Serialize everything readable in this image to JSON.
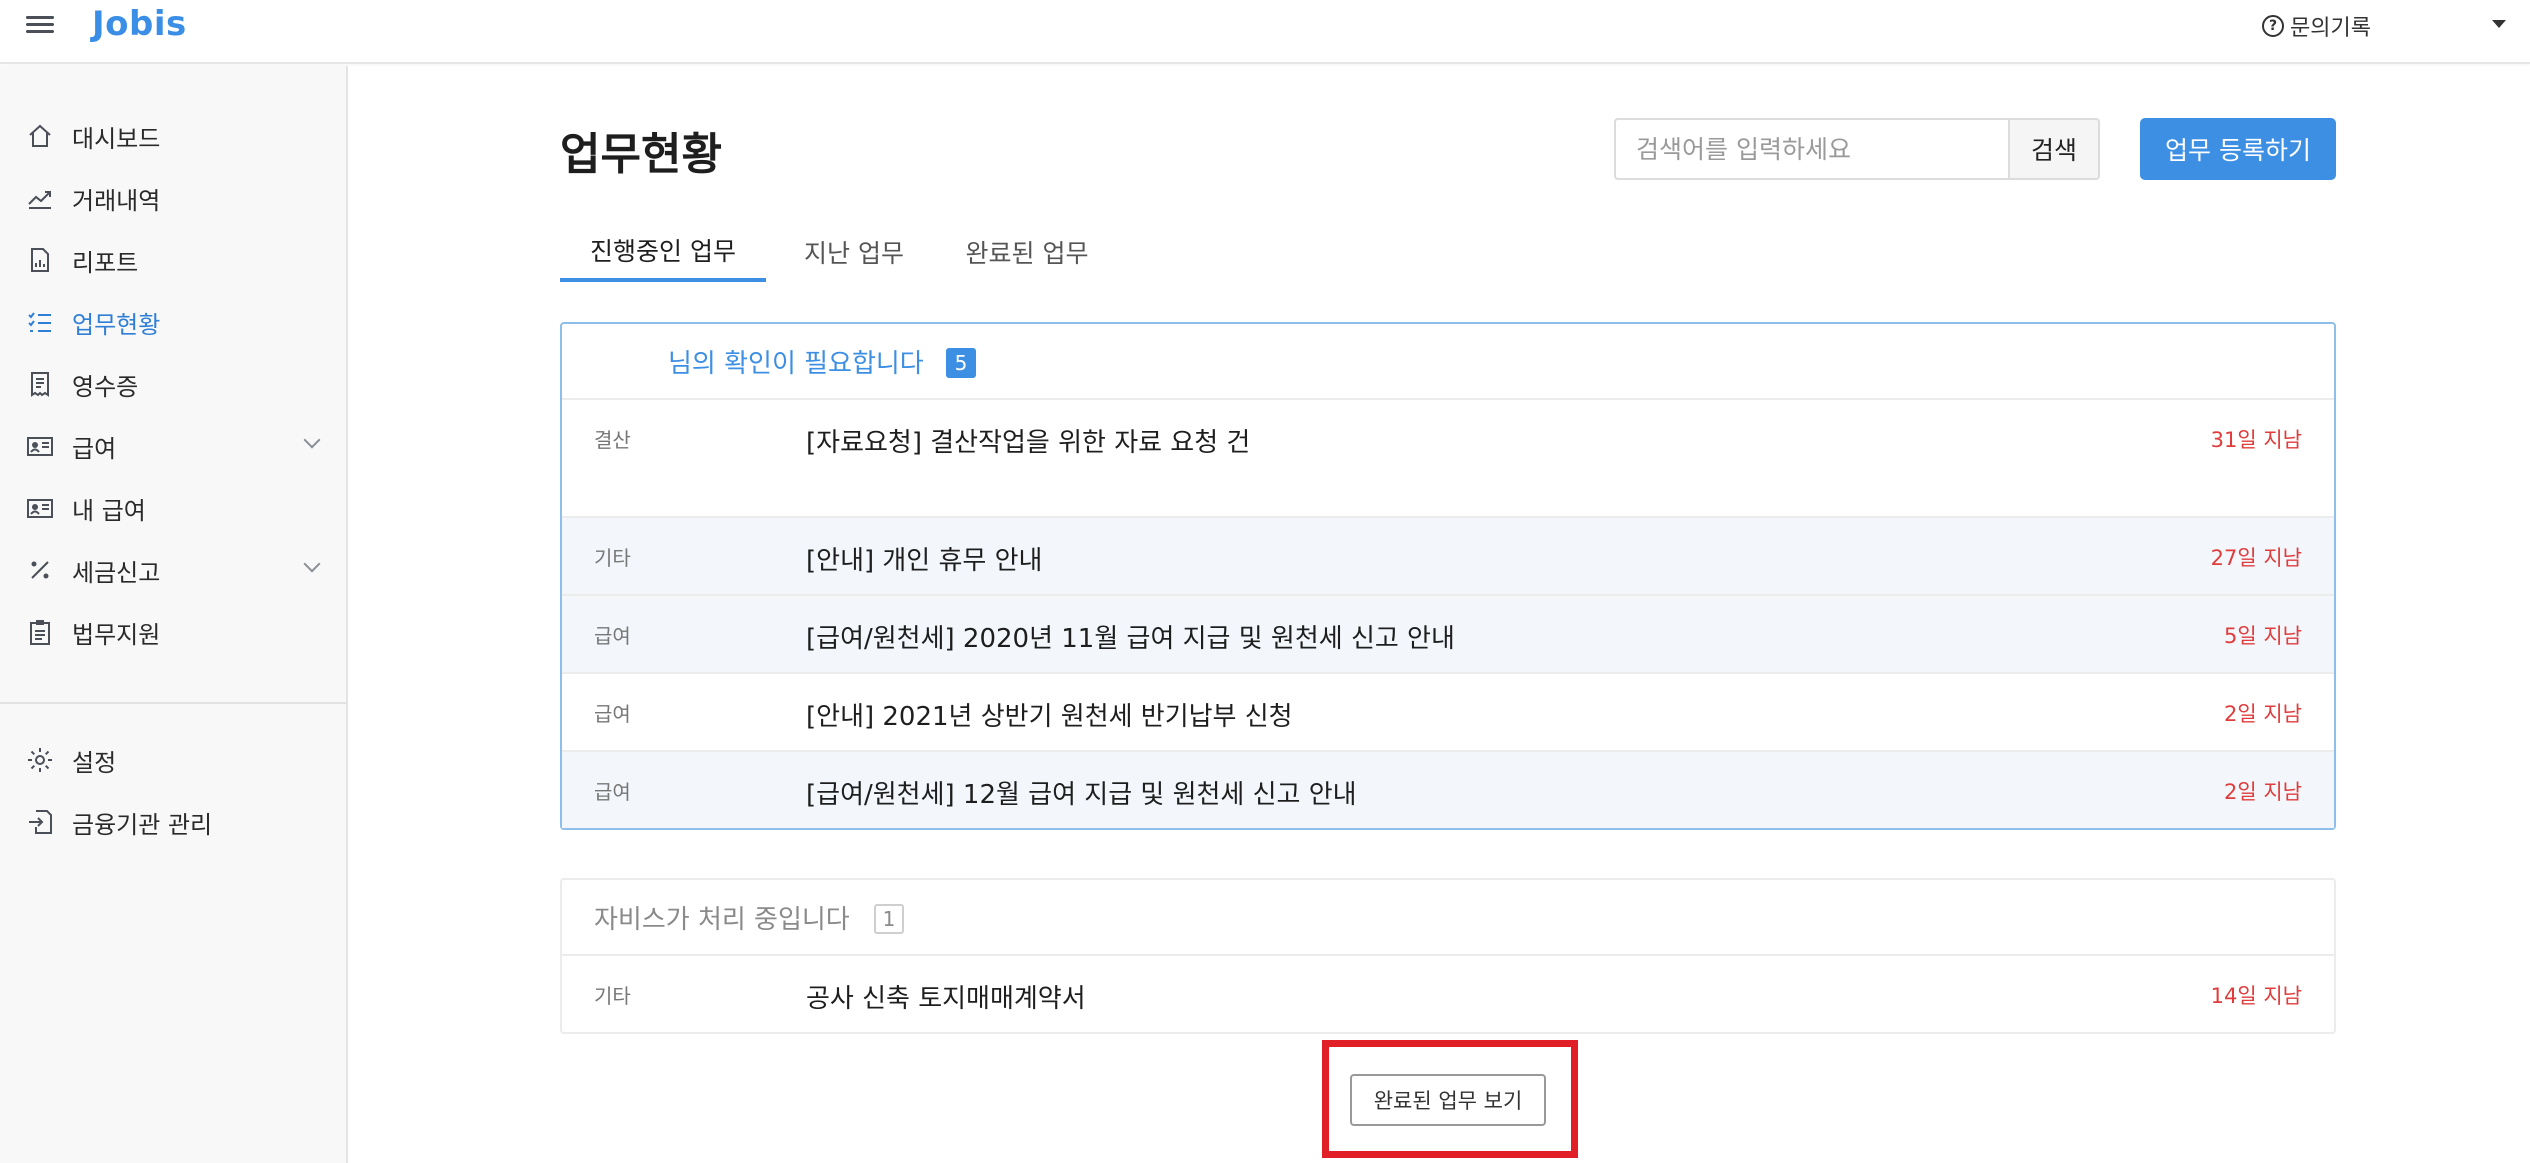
{
  "app": {
    "logo": "Jobis"
  },
  "header": {
    "help_label": "문의기록",
    "help_icon": "question-circle-icon"
  },
  "sidebar": {
    "items": [
      {
        "label": "대시보드",
        "icon": "home-icon"
      },
      {
        "label": "거래내역",
        "icon": "trend-chart-icon"
      },
      {
        "label": "리포트",
        "icon": "document-chart-icon"
      },
      {
        "label": "업무현황",
        "icon": "checklist-icon",
        "active": true
      },
      {
        "label": "영수증",
        "icon": "receipt-icon"
      },
      {
        "label": "급여",
        "icon": "id-card-icon",
        "expandable": true
      },
      {
        "label": "내 급여",
        "icon": "id-card-icon"
      },
      {
        "label": "세금신고",
        "icon": "percent-icon",
        "expandable": true
      },
      {
        "label": "법무지원",
        "icon": "clipboard-icon"
      }
    ],
    "bottom_items": [
      {
        "label": "설정",
        "icon": "gear-icon"
      },
      {
        "label": "금융기관 관리",
        "icon": "bank-import-icon"
      }
    ]
  },
  "main": {
    "title": "업무현황",
    "search": {
      "placeholder": "검색어를 입력하세요",
      "button_label": "검색"
    },
    "register_label": "업무 등록하기",
    "tabs": [
      {
        "label": "진행중인 업무",
        "active": true
      },
      {
        "label": "지난 업무"
      },
      {
        "label": "완료된 업무"
      }
    ],
    "needs_confirmation": {
      "title": "님의 확인이 필요합니다",
      "count": "5",
      "rows": [
        {
          "category": "결산",
          "subject": "[자료요청] 결산작업을 위한 자료 요청 건",
          "due": "31일 지남"
        },
        {
          "category": "기타",
          "subject": "[안내] 개인 휴무 안내",
          "due": "27일 지남"
        },
        {
          "category": "급여",
          "subject": "[급여/원천세] 2020년 11월 급여 지급 및 원천세 신고 안내",
          "due": "5일 지남"
        },
        {
          "category": "급여",
          "subject": "[안내] 2021년 상반기 원천세 반기납부 신청",
          "due": "2일 지남"
        },
        {
          "category": "급여",
          "subject": "[급여/원천세] 12월 급여 지급 및 원천세 신고 안내",
          "due": "2일 지남"
        }
      ]
    },
    "processing": {
      "title": "자비스가 처리 중입니다",
      "count": "1",
      "rows": [
        {
          "category": "기타",
          "subject": "공사 신축 토지매매계약서",
          "due": "14일 지남"
        }
      ]
    },
    "completed_button_label": "완료된 업무 보기"
  },
  "colors": {
    "accent": "#3d8fe3",
    "overdue": "#e03c3c",
    "highlight": "#e01f26"
  }
}
